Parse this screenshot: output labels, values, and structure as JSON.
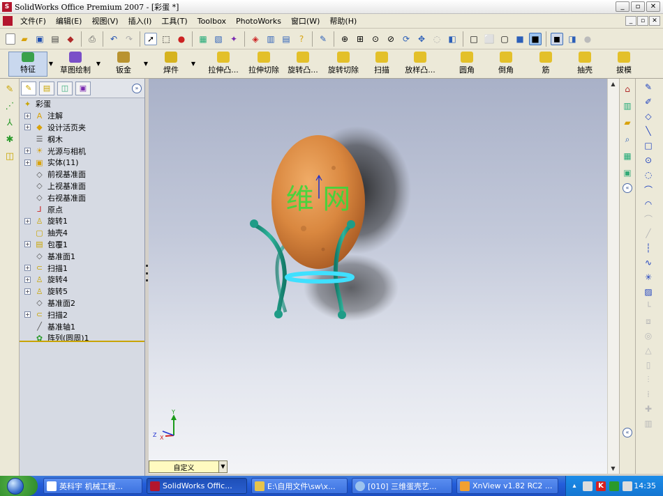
{
  "window": {
    "title": "SolidWorks Office Premium 2007 - [彩蛋 *]"
  },
  "menu": {
    "items": [
      "文件(F)",
      "编辑(E)",
      "视图(V)",
      "插入(I)",
      "工具(T)",
      "Toolbox",
      "PhotoWorks",
      "窗口(W)",
      "帮助(H)"
    ]
  },
  "command_manager": {
    "tabs": [
      "特征",
      "草图绘制",
      "钣金",
      "焊件"
    ],
    "commands": [
      "拉伸凸...",
      "拉伸切除",
      "旋转凸...",
      "旋转切除",
      "扫描",
      "放样凸...",
      "圆角",
      "倒角",
      "筋",
      "抽壳",
      "拔模"
    ]
  },
  "feature_tree": {
    "root": "彩蛋",
    "items": [
      {
        "label": "注解",
        "icon": "annotation-icon",
        "expand": true
      },
      {
        "label": "设计活页夹",
        "icon": "design-binder-icon",
        "expand": true
      },
      {
        "label": "㭎木",
        "icon": "material-icon",
        "expand": false
      },
      {
        "label": "光源与相机",
        "icon": "lights-icon",
        "expand": true
      },
      {
        "label": "实体(11)",
        "icon": "solid-bodies-icon",
        "expand": true
      },
      {
        "label": "前视基准面",
        "icon": "plane-icon",
        "expand": false
      },
      {
        "label": "上视基准面",
        "icon": "plane-icon",
        "expand": false
      },
      {
        "label": "右视基准面",
        "icon": "plane-icon",
        "expand": false
      },
      {
        "label": "原点",
        "icon": "origin-icon",
        "expand": false
      },
      {
        "label": "旋转1",
        "icon": "revolve-icon",
        "expand": true
      },
      {
        "label": "抽壳4",
        "icon": "shell-icon",
        "expand": false
      },
      {
        "label": "包覆1",
        "icon": "wrap-icon",
        "expand": true
      },
      {
        "label": "基准面1",
        "icon": "plane-icon",
        "expand": false
      },
      {
        "label": "扫描1",
        "icon": "sweep-icon",
        "expand": true
      },
      {
        "label": "旋转4",
        "icon": "revolve-icon",
        "expand": true
      },
      {
        "label": "旋转5",
        "icon": "revolve-icon",
        "expand": true
      },
      {
        "label": "基准面2",
        "icon": "plane-icon",
        "expand": false
      },
      {
        "label": "扫描2",
        "icon": "sweep-icon",
        "expand": true
      },
      {
        "label": "基准轴1",
        "icon": "axis-icon",
        "expand": false
      },
      {
        "label": "阵列(圆周)1",
        "icon": "circular-pattern-icon",
        "expand": false
      }
    ]
  },
  "viewport": {
    "egg_text": "维 网",
    "triad": {
      "x_label": "X",
      "y_label": "Y",
      "z_label": "Z"
    },
    "view_orientation": "自定义"
  },
  "taskbar": {
    "tasks": [
      "英科宇 机械工程...",
      "SolidWorks Offic...",
      "E:\\自用文件\\sw\\x...",
      "[010] 三维蛋壳艺...",
      "XnView v1.82 RC2 ..."
    ],
    "clock": "14:35"
  },
  "colors": {
    "egg": "#d9873f",
    "stand": "#1f9c87",
    "ring": "#3fe0ff",
    "watermark": "#39d83b"
  }
}
